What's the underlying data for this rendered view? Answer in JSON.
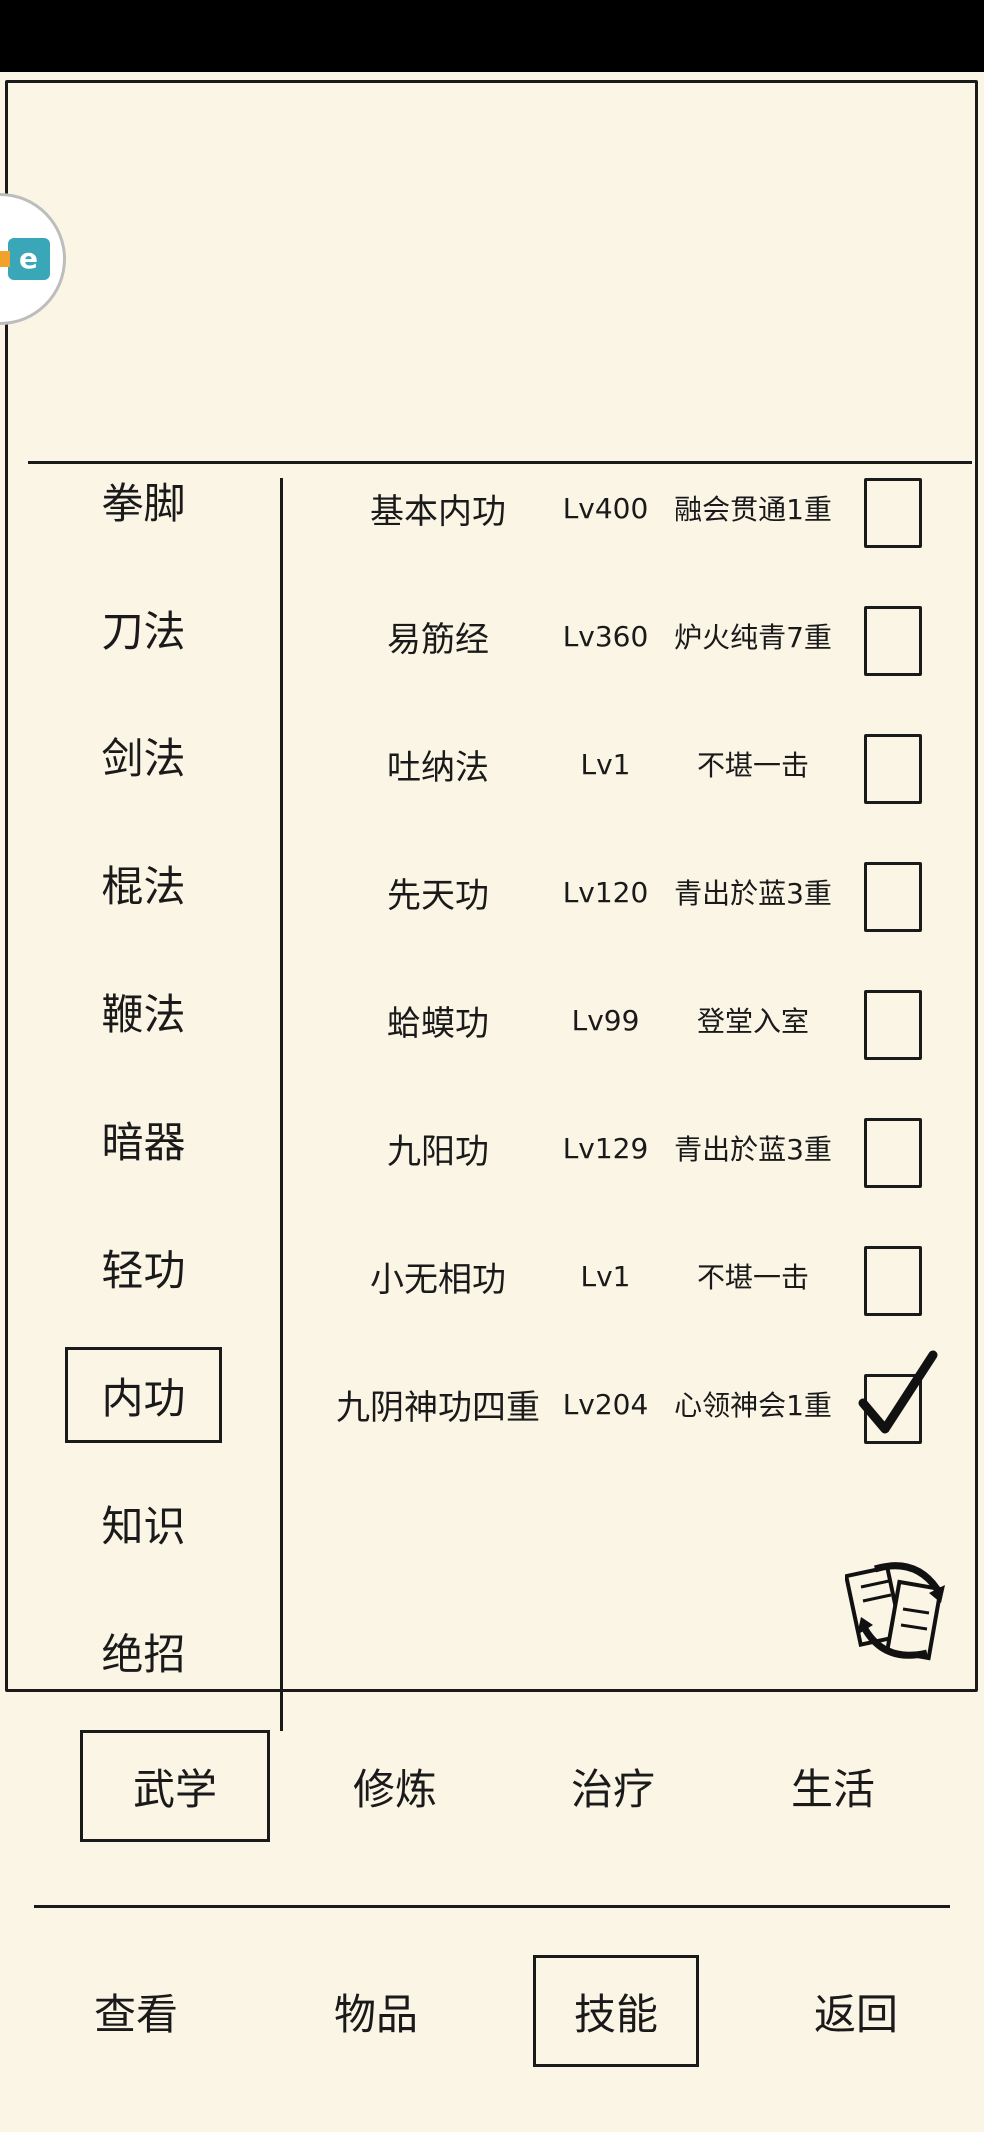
{
  "categories": [
    {
      "label": "拳脚",
      "selected": false
    },
    {
      "label": "刀法",
      "selected": false
    },
    {
      "label": "剑法",
      "selected": false
    },
    {
      "label": "棍法",
      "selected": false
    },
    {
      "label": "鞭法",
      "selected": false
    },
    {
      "label": "暗器",
      "selected": false
    },
    {
      "label": "轻功",
      "selected": false
    },
    {
      "label": "内功",
      "selected": true
    },
    {
      "label": "知识",
      "selected": false
    },
    {
      "label": "绝招",
      "selected": false
    }
  ],
  "skills": [
    {
      "name": "基本内功",
      "level": "Lv400",
      "rank": "融会贯通1重",
      "checked": false
    },
    {
      "name": "易筋经",
      "level": "Lv360",
      "rank": "炉火纯青7重",
      "checked": false
    },
    {
      "name": "吐纳法",
      "level": "Lv1",
      "rank": "不堪一击",
      "checked": false
    },
    {
      "name": "先天功",
      "level": "Lv120",
      "rank": "青出於蓝3重",
      "checked": false
    },
    {
      "name": "蛤蟆功",
      "level": "Lv99",
      "rank": "登堂入室",
      "checked": false
    },
    {
      "name": "九阳功",
      "level": "Lv129",
      "rank": "青出於蓝3重",
      "checked": false
    },
    {
      "name": "小无相功",
      "level": "Lv1",
      "rank": "不堪一击",
      "checked": false
    },
    {
      "name": "九阴神功四重",
      "level": "Lv204",
      "rank": "心领神会1重",
      "checked": true
    }
  ],
  "tabs": [
    {
      "label": "武学",
      "selected": true
    },
    {
      "label": "修炼",
      "selected": false
    },
    {
      "label": "治疗",
      "selected": false
    },
    {
      "label": "生活",
      "selected": false
    }
  ],
  "nav": [
    {
      "label": "查看",
      "selected": false
    },
    {
      "label": "物品",
      "selected": false
    },
    {
      "label": "技能",
      "selected": true
    },
    {
      "label": "返回",
      "selected": false
    }
  ],
  "logo": {
    "glyph": "e"
  },
  "icons": {
    "swap": "swap-icon",
    "logo": "app-logo-icon",
    "check": "checkmark-icon"
  }
}
